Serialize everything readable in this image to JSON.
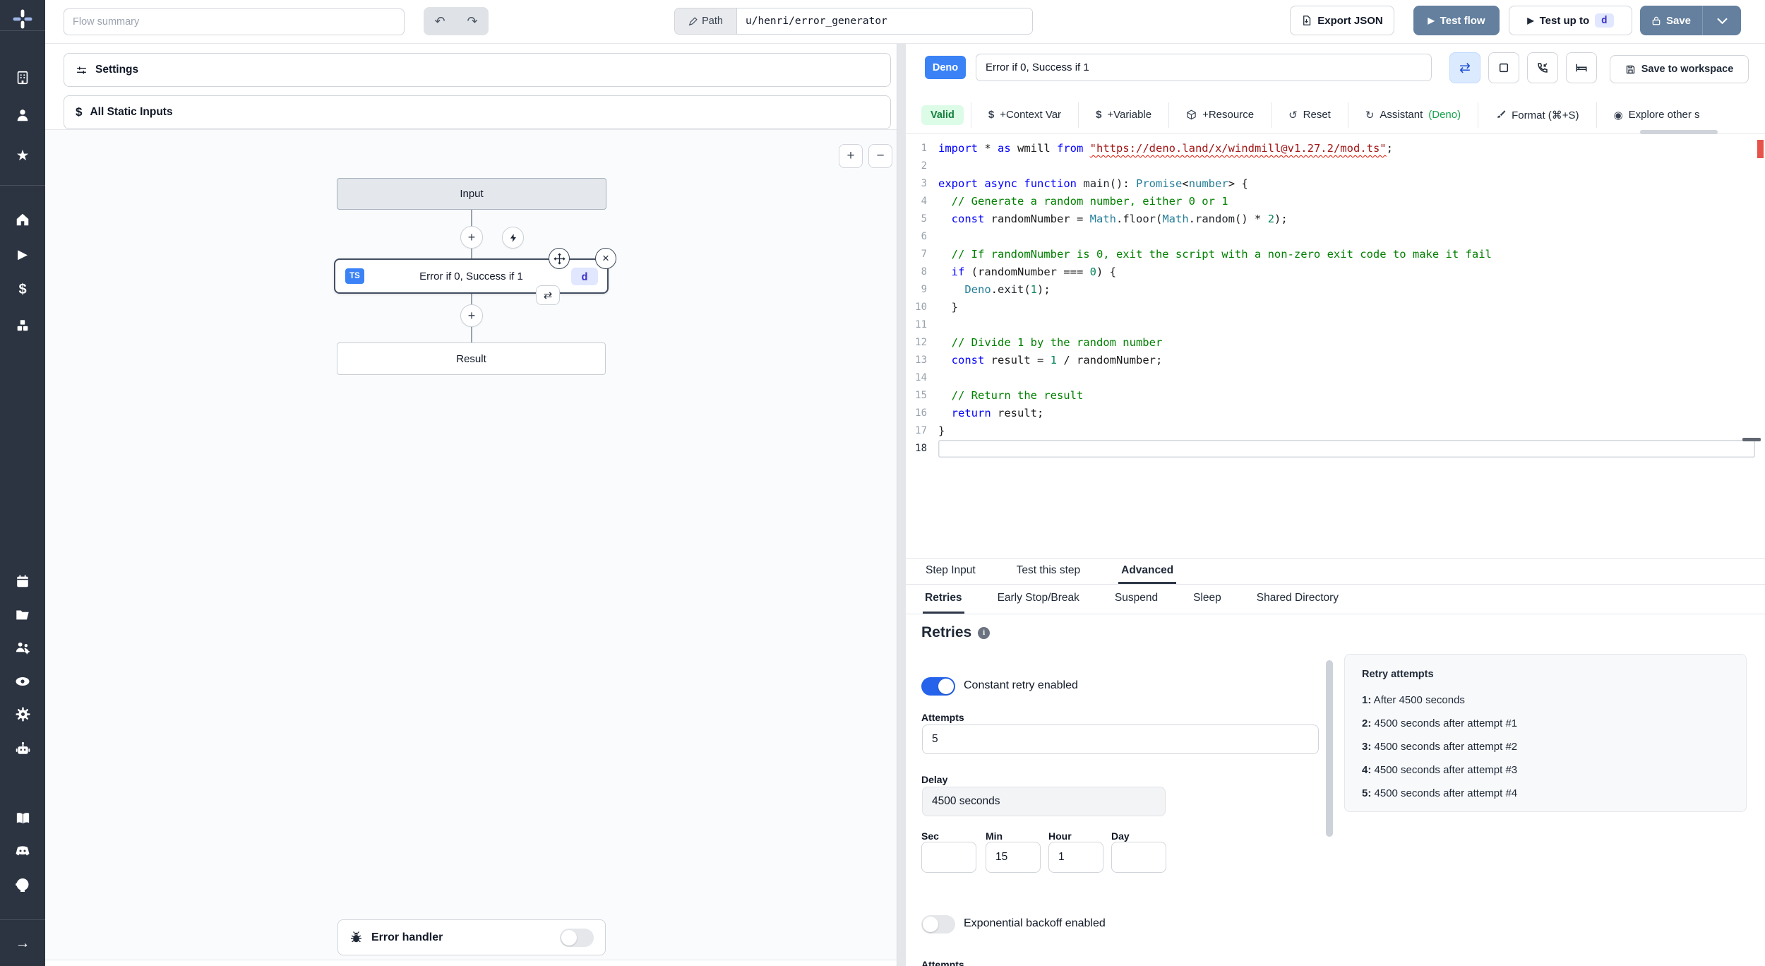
{
  "icons": {
    "undo": "↶",
    "redo": "↷",
    "plus": "+",
    "minus": "−",
    "close": "×",
    "cycle": "⇄",
    "reset": "↺",
    "refresh": "↻",
    "eye_circle": "◉",
    "dollar": "$",
    "arrow_right": "→",
    "star": "★",
    "play": "▶"
  },
  "colors": {
    "accent_blue": "#64809e",
    "badge_blue": "#3b82f6",
    "toggle_on": "#2563eb",
    "valid_green": "#15803d",
    "error_red": "#e5534b",
    "indigo": "#4338ca",
    "sidebar": "#2c3442"
  },
  "sidebar_icon_names": [
    "windmill-logo",
    "workspace",
    "user",
    "favorites",
    "home",
    "runs",
    "variables",
    "resources",
    "schedules",
    "folders",
    "groups",
    "audit",
    "settings",
    "ai-assistant",
    "docs",
    "discord",
    "github",
    "expand-sidebar"
  ],
  "topbar": {
    "flow_summary_placeholder": "Flow summary",
    "path_label": "Path",
    "path_value": "u/henri/error_generator",
    "export_json": "Export JSON",
    "test_flow": "Test flow",
    "test_up_to": "Test up to",
    "test_up_to_badge": "d",
    "save": "Save"
  },
  "flow": {
    "settings": "Settings",
    "all_static_inputs": "All Static Inputs",
    "input_node": "Input",
    "step": {
      "lang": "TS",
      "label": "Error if 0, Success if 1",
      "id": "d"
    },
    "result_node": "Result",
    "error_handler": "Error handler"
  },
  "editor": {
    "lang_badge": "Deno",
    "step_name": "Error if 0, Success if 1",
    "save_to_workspace": "Save to workspace",
    "toolbar": {
      "valid": "Valid",
      "items": [
        "+Context Var",
        "+Variable",
        "+Resource",
        "Reset",
        "Assistant",
        "Format (⌘+S)",
        "Explore other s"
      ],
      "assistant_suffix": "(Deno)"
    },
    "tabs": [
      "Step Input",
      "Test this step",
      "Advanced"
    ],
    "subtabs": [
      "Retries",
      "Early Stop/Break",
      "Suspend",
      "Sleep",
      "Shared Directory"
    ],
    "code": {
      "active_line": 18,
      "lines": [
        [
          [
            "kw",
            "import"
          ],
          [
            "d",
            " * "
          ],
          [
            "kw",
            "as"
          ],
          [
            "d",
            " wmill "
          ],
          [
            "kw",
            "from"
          ],
          [
            "d",
            " "
          ],
          [
            "str sq",
            "\"https://deno.land/x/windmill@v1.27.2/mod.ts\""
          ],
          [
            "d",
            ";"
          ]
        ],
        [],
        [
          [
            "kw",
            "export"
          ],
          [
            "d",
            " "
          ],
          [
            "kw",
            "async"
          ],
          [
            "d",
            " "
          ],
          [
            "kw",
            "function"
          ],
          [
            "d",
            " "
          ],
          [
            "fn",
            "main"
          ],
          [
            "d",
            "(): "
          ],
          [
            "ty",
            "Promise"
          ],
          [
            "d",
            "<"
          ],
          [
            "ty",
            "number"
          ],
          [
            "d",
            "> {"
          ]
        ],
        [
          [
            "cm",
            "  // Generate a random number, either 0 or 1"
          ]
        ],
        [
          [
            "d",
            "  "
          ],
          [
            "kw",
            "const"
          ],
          [
            "d",
            " randomNumber = "
          ],
          [
            "ty",
            "Math"
          ],
          [
            "d",
            "."
          ],
          [
            "fn",
            "floor"
          ],
          [
            "d",
            "("
          ],
          [
            "ty",
            "Math"
          ],
          [
            "d",
            "."
          ],
          [
            "fn",
            "random"
          ],
          [
            "d",
            "() * "
          ],
          [
            "num",
            "2"
          ],
          [
            "d",
            ");"
          ]
        ],
        [],
        [
          [
            "cm",
            "  // If randomNumber is 0, exit the script with a non-zero exit code to make it fail"
          ]
        ],
        [
          [
            "d",
            "  "
          ],
          [
            "kw",
            "if"
          ],
          [
            "d",
            " (randomNumber === "
          ],
          [
            "num",
            "0"
          ],
          [
            "d",
            ") {"
          ]
        ],
        [
          [
            "d",
            "    "
          ],
          [
            "ty",
            "Deno"
          ],
          [
            "d",
            "."
          ],
          [
            "fn",
            "exit"
          ],
          [
            "d",
            "("
          ],
          [
            "num",
            "1"
          ],
          [
            "d",
            ");"
          ]
        ],
        [
          [
            "d",
            "  }"
          ]
        ],
        [],
        [
          [
            "cm",
            "  // Divide 1 by the random number"
          ]
        ],
        [
          [
            "d",
            "  "
          ],
          [
            "kw",
            "const"
          ],
          [
            "d",
            " result = "
          ],
          [
            "num",
            "1"
          ],
          [
            "d",
            " / randomNumber;"
          ]
        ],
        [],
        [
          [
            "cm",
            "  // Return the result"
          ]
        ],
        [
          [
            "d",
            "  "
          ],
          [
            "kw",
            "return"
          ],
          [
            "d",
            " result;"
          ]
        ],
        [
          [
            "d",
            "}"
          ]
        ],
        []
      ]
    },
    "retries": {
      "heading": "Retries",
      "constant_label": "Constant retry enabled",
      "attempts_label": "Attempts",
      "attempts_value": "5",
      "delay_label": "Delay",
      "delay_value": "4500 seconds",
      "time_fields": [
        {
          "label": "Sec",
          "value": ""
        },
        {
          "label": "Min",
          "value": "15"
        },
        {
          "label": "Hour",
          "value": "1"
        },
        {
          "label": "Day",
          "value": ""
        }
      ],
      "exponential_label": "Exponential backoff enabled",
      "clipped_label": "Attempts",
      "retry_attempts": {
        "title": "Retry attempts",
        "items": [
          {
            "n": "1:",
            "text": "After 4500 seconds"
          },
          {
            "n": "2:",
            "text": "4500 seconds after attempt #1"
          },
          {
            "n": "3:",
            "text": "4500 seconds after attempt #2"
          },
          {
            "n": "4:",
            "text": "4500 seconds after attempt #3"
          },
          {
            "n": "5:",
            "text": "4500 seconds after attempt #4"
          }
        ]
      }
    }
  }
}
